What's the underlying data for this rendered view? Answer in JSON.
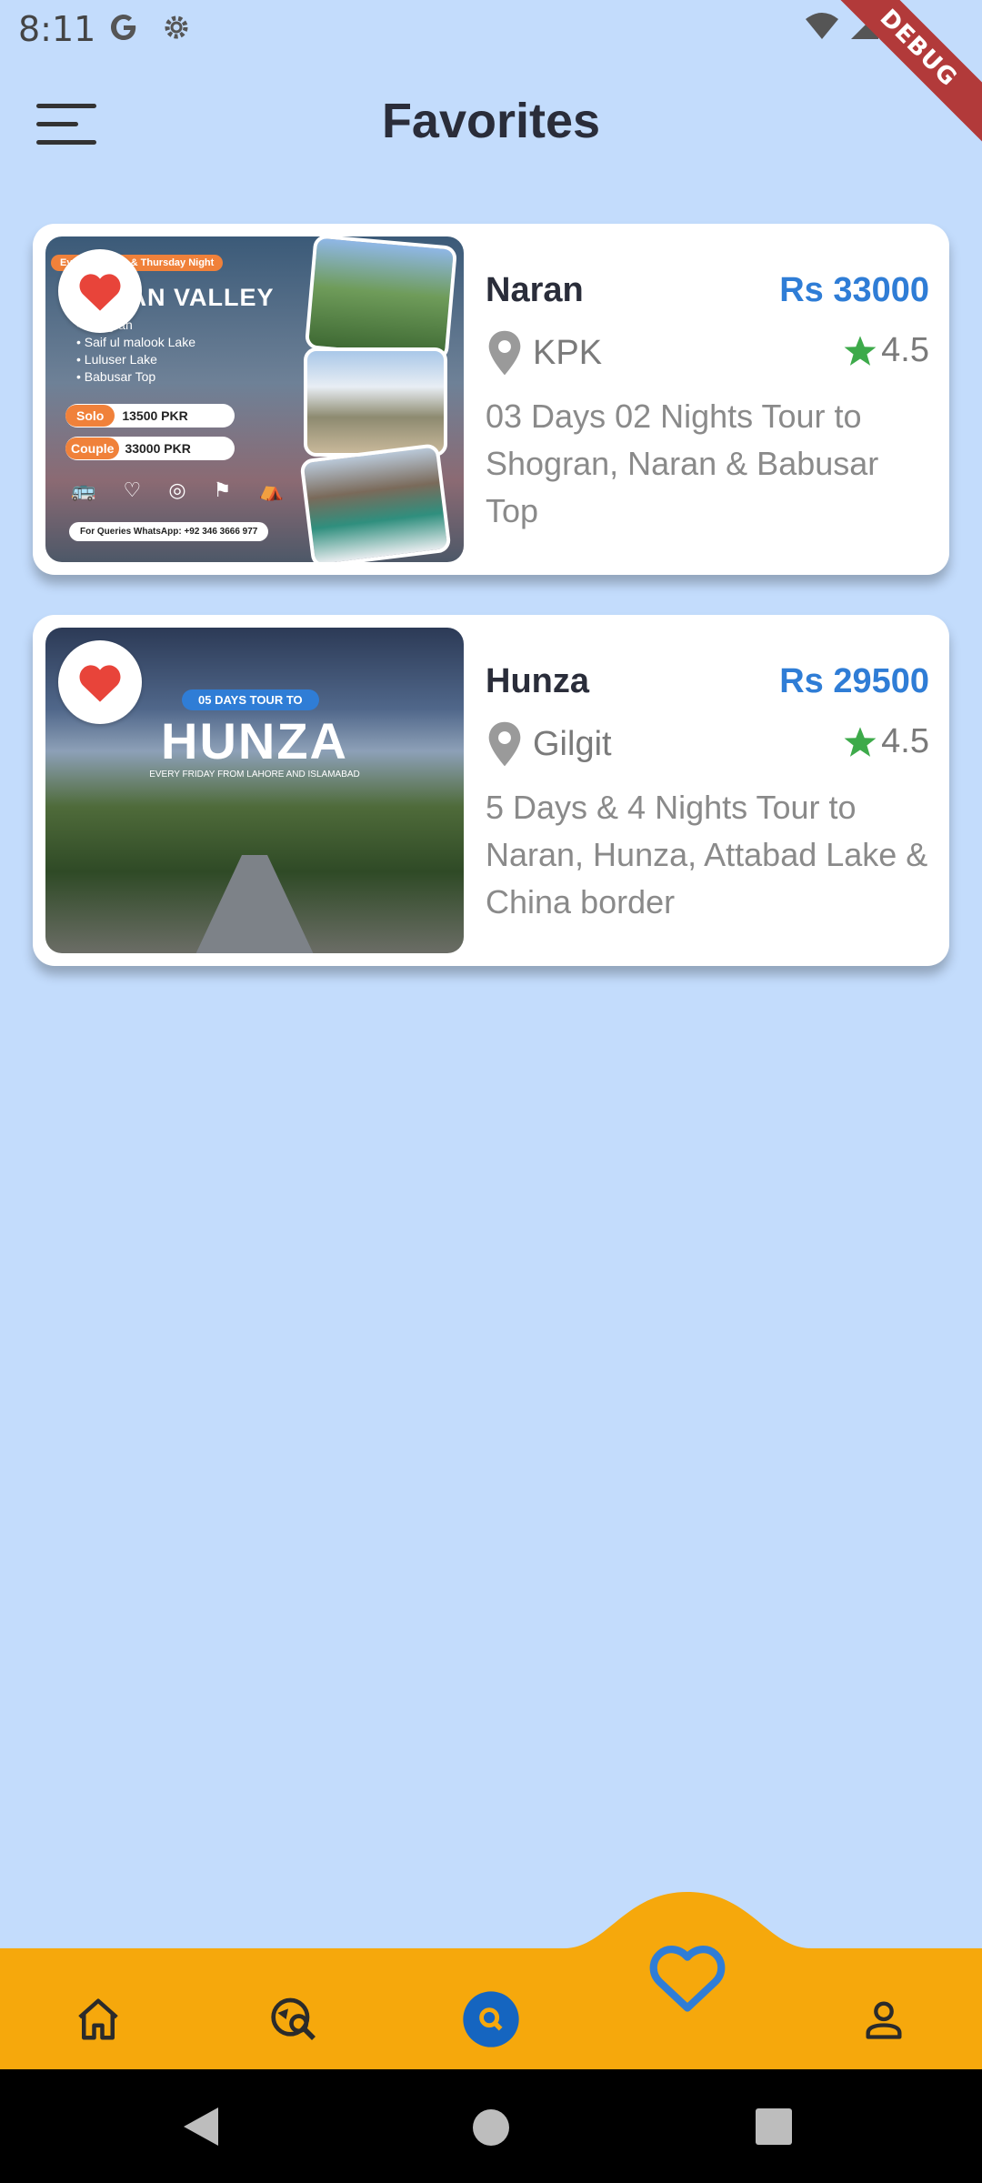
{
  "status_bar": {
    "time": "8:11",
    "debug_label": "DEBUG"
  },
  "header": {
    "title": "Favorites"
  },
  "cards": [
    {
      "name": "Naran",
      "price": "Rs 33000",
      "location": "KPK",
      "rating": "4.5",
      "description": "03 Days 02 Nights Tour to Shogran, Naran & Babusar Top",
      "poster": {
        "tag": "Every Monday & Thursday Night",
        "title": "NARAN VALLEY",
        "bullets": [
          "Shogran",
          "Saif ul malook Lake",
          "Luluser Lake",
          "Babusar Top"
        ],
        "solo_label": "Solo",
        "solo_price": "13500 PKR",
        "couple_label": "Couple",
        "couple_price": "33000 PKR",
        "contact": "For Queries WhatsApp: +92 346 3666 977"
      }
    },
    {
      "name": "Hunza",
      "price": "Rs 29500",
      "location": "Gilgit",
      "rating": "4.5",
      "description": "5 Days & 4 Nights Tour to Naran, Hunza, Attabad Lake & China border",
      "poster": {
        "tag": "05 DAYS TOUR TO",
        "title": "HUNZA",
        "subtitle": "EVERY FRIDAY FROM LAHORE AND ISLAMABAD"
      }
    }
  ],
  "bottom_nav": {
    "items": [
      "home-icon",
      "explore-search-icon",
      "search-icon",
      "favorite-icon",
      "profile-icon"
    ],
    "active": "favorite-icon"
  },
  "colors": {
    "background": "#c3dcfc",
    "accent": "#2f7dd6",
    "nav_bar": "#f6a80c",
    "heart": "#e8443a",
    "star": "#3daa4a"
  }
}
